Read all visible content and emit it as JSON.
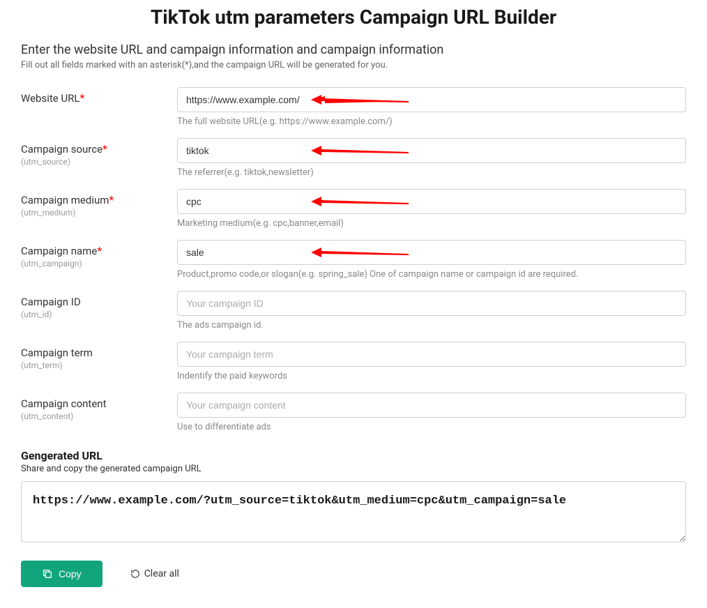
{
  "title": "TikTok utm parameters Campaign URL Builder",
  "intro": {
    "heading": "Enter the website URL and campaign information and campaign information",
    "sub": "Fill out all fields marked with an asterisk(*),and the campaign URL will be generated for you."
  },
  "fields": {
    "website_url": {
      "label": "Website URL",
      "required": true,
      "sub": "",
      "value": "https://www.example.com/",
      "placeholder": "",
      "helper": "The full website URL(e.g. https://www.example.com/)"
    },
    "campaign_source": {
      "label": "Campaign source",
      "required": true,
      "sub": "(utm_source)",
      "value": "tiktok",
      "placeholder": "",
      "helper": "The referrer(e.g. tiktok,newsletter)"
    },
    "campaign_medium": {
      "label": "Campaign medium",
      "required": true,
      "sub": "(utm_medium)",
      "value": "cpc",
      "placeholder": "",
      "helper": "Marketing medium(e.g. cpc,banner,email)"
    },
    "campaign_name": {
      "label": "Campaign name",
      "required": true,
      "sub": "(utm_campaign)",
      "value": "sale",
      "placeholder": "",
      "helper": "Product,promo code,or slogan(e.g. spring_sale) One of campaign name or campaign id are required."
    },
    "campaign_id": {
      "label": "Campaign ID",
      "required": false,
      "sub": "(utm_id)",
      "value": "",
      "placeholder": "Your campaign ID",
      "helper": "The ads campaign id."
    },
    "campaign_term": {
      "label": "Campaign term",
      "required": false,
      "sub": "(utm_term)",
      "value": "",
      "placeholder": "Your campaign term",
      "helper": "Indentify the paid keywords"
    },
    "campaign_content": {
      "label": "Campaign content",
      "required": false,
      "sub": "(utm_content)",
      "value": "",
      "placeholder": "Your campaign content",
      "helper": "Use to differentiate ads"
    }
  },
  "generated": {
    "title": "Gengerated URL",
    "sub": "Share and copy the generated campaign URL",
    "value": "https://www.example.com/?utm_source=tiktok&utm_medium=cpc&utm_campaign=sale"
  },
  "actions": {
    "copy": "Copy",
    "clear": "Clear all"
  },
  "required_star": "*"
}
